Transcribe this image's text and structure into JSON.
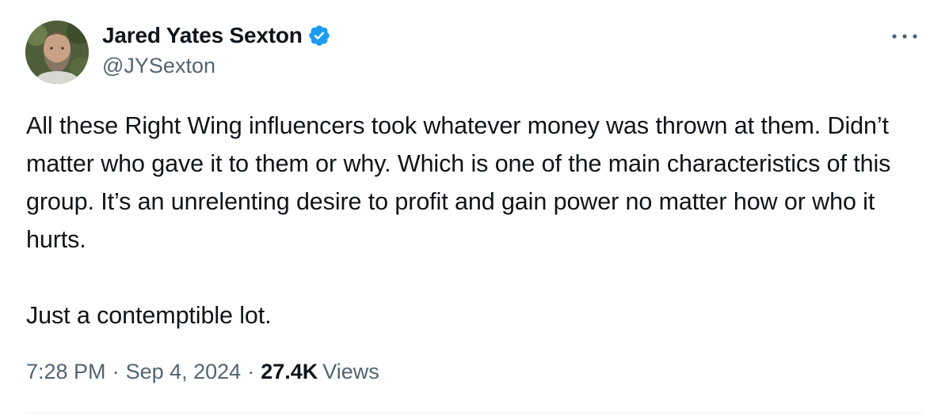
{
  "author": {
    "display_name": "Jared Yates Sexton",
    "handle": "@JYSexton",
    "verified": true,
    "verified_color": "#1d9bf0"
  },
  "tweet": {
    "paragraphs": [
      "All these Right Wing influencers took whatever money was thrown at them. Didn’t matter who gave it to them or why. Which is one of the main characteristics of this group. It’s an unrelenting desire to profit and gain power no matter how or who it hurts.",
      "Just a contemptible lot."
    ]
  },
  "meta": {
    "time": "7:28 PM",
    "separator": "·",
    "date": "Sep 4, 2024",
    "views_count": "27.4K",
    "views_label": "Views"
  },
  "icons": {
    "more": "more-horizontal-icon",
    "verified": "verified-badge-icon"
  }
}
